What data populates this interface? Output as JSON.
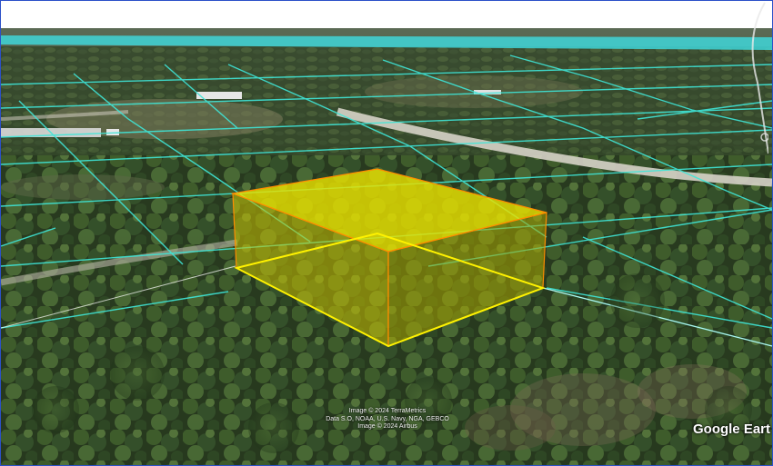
{
  "app": {
    "name": "Google Earth"
  },
  "map": {
    "view": "3D aerial, oblique tilt",
    "parcel_line_color": "#3fe6d8",
    "highlight_box_color": "#e8e000",
    "highlight_edge_color": "#ffb000"
  },
  "attribution": {
    "line1": "Image © 2024 TerraMetrics",
    "line2": "Data S.O, NOAA, U.S. Navy, NGA, GEBCO",
    "line3": "Image © 2024 Airbus"
  },
  "logo": {
    "text": "Google Eart"
  },
  "icons": {
    "navigation": "compass-ring-icon"
  }
}
